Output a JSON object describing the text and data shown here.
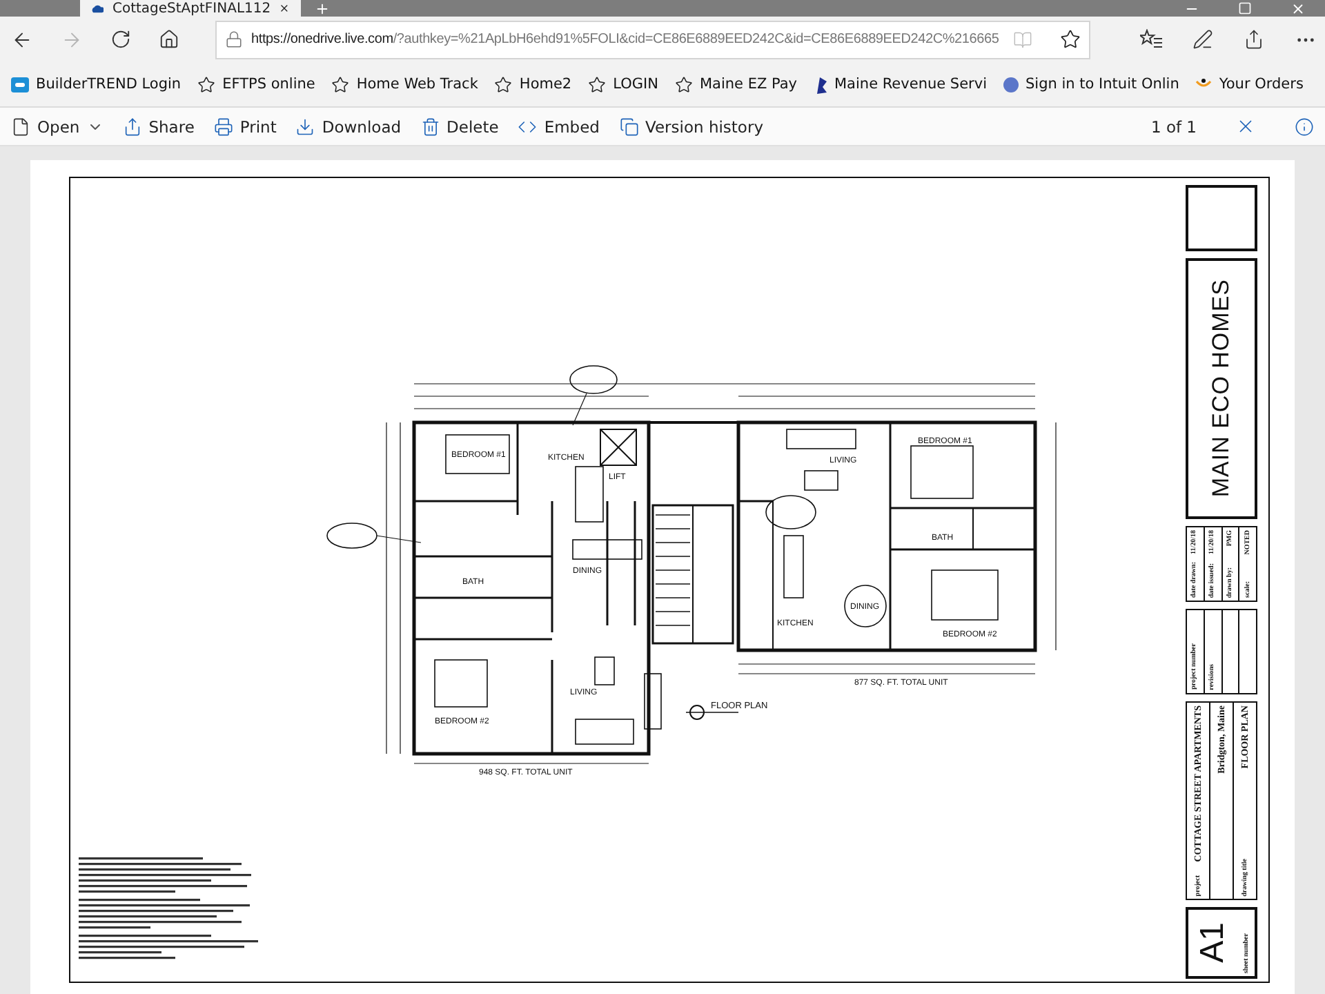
{
  "browser": {
    "tab": {
      "title": "CottageStAptFINAL112"
    },
    "nav": [
      {
        "kind": "back",
        "disabled": false
      },
      {
        "kind": "forward",
        "disabled": true
      },
      {
        "kind": "refresh",
        "disabled": false
      },
      {
        "kind": "home",
        "disabled": false
      }
    ],
    "address": {
      "url_host": "https://onedrive.live.com",
      "url_rest": "/?authkey=%21ApLbH6ehd91%5FOLI&cid=CE86E6889EED242C&id=CE86E6889EED242C%216665"
    },
    "bookmarks": [
      {
        "kind": "app",
        "label": "BuilderTREND Login"
      },
      {
        "kind": "star",
        "label": "EFTPS online"
      },
      {
        "kind": "star",
        "label": "Home  Web Track"
      },
      {
        "kind": "star",
        "label": "Home2"
      },
      {
        "kind": "star",
        "label": "LOGIN"
      },
      {
        "kind": "star",
        "label": "Maine EZ Pay"
      },
      {
        "kind": "flag",
        "label": "Maine Revenue Servi"
      },
      {
        "kind": "circle",
        "label": "Sign in to Intuit Onlin"
      },
      {
        "kind": "smile",
        "label": "Your Orders"
      }
    ]
  },
  "commands": [
    {
      "kind": "file",
      "label": "Open",
      "dropdown": true
    },
    {
      "kind": "share",
      "label": "Share",
      "dropdown": false
    },
    {
      "kind": "print",
      "label": "Print",
      "dropdown": false
    },
    {
      "kind": "download",
      "label": "Download",
      "dropdown": false
    },
    {
      "kind": "delete",
      "label": "Delete",
      "dropdown": false
    },
    {
      "kind": "embed",
      "label": "Embed",
      "dropdown": false
    },
    {
      "kind": "history",
      "label": "Version history",
      "dropdown": false
    }
  ],
  "page_count": "1 of 1",
  "plan": {
    "labels": [
      "BEDROOM #1",
      "KITCHEN",
      "LIFT",
      "DINING",
      "BATH",
      "LIVING",
      "BEDROOM #2",
      "LIVING",
      "BEDROOM #1",
      "BATH",
      "KITCHEN",
      "DINING",
      "BEDROOM #2"
    ],
    "title": "FLOOR PLAN",
    "totals": [
      "948 SQ. FT. TOTAL UNIT",
      "877 SQ. FT. TOTAL UNIT"
    ]
  },
  "title_block": {
    "company": "MAIN ECO HOMES",
    "dates": [
      {
        "label": "date drawn:",
        "value": "11/20/18"
      },
      {
        "label": "date issued:",
        "value": "11/20/18"
      },
      {
        "label": "drawn by:",
        "value": "PMG"
      },
      {
        "label": "scale:",
        "value": "NOTED"
      }
    ],
    "project_number_label": "project number",
    "revisions_label": "revisions",
    "project_label": "project",
    "project_name": "COTTAGE STREET APARTMENTS",
    "project_place": "Bridgton, Maine",
    "drawing_title_label": "drawing title",
    "drawing_title": "FLOOR PLAN",
    "sheet": "A1",
    "sheet_label": "sheet number"
  }
}
